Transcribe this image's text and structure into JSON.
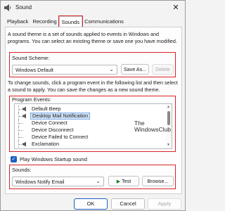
{
  "window": {
    "title": "Sound"
  },
  "tabs": [
    {
      "label": "Playback"
    },
    {
      "label": "Recording"
    },
    {
      "label": "Sounds"
    },
    {
      "label": "Communications"
    }
  ],
  "description": "A sound theme is a set of sounds applied to events in Windows and programs. You can select an existing theme or save one you have modified.",
  "scheme": {
    "label": "Sound Scheme:",
    "value": "Windows Default",
    "save_label": "Save As...",
    "delete_label": "Delete"
  },
  "instructions": "To change sounds, click a program event in the following list and then select a sound to apply. You can save the changes as a new sound theme.",
  "events": {
    "label": "Program Events:",
    "items": [
      "Default Beep",
      "Desktop Mail Notification",
      "Device Connect",
      "Device Disconnect",
      "Device Failed to Connect",
      "Exclamation"
    ],
    "selected_index": 1
  },
  "watermark": {
    "line1": "The",
    "line2": "WindowsClub"
  },
  "startup": {
    "label": "Play Windows Startup sound",
    "checked": true
  },
  "sounds": {
    "label": "Sounds:",
    "value": "Windows Notify Email",
    "test_label": "Test",
    "browse_label": "Browse..."
  },
  "footer": {
    "ok_label": "OK",
    "cancel_label": "Cancel",
    "apply_label": "Apply"
  },
  "colors": {
    "highlight": "#d8232a",
    "accent": "#1f5fbf",
    "selection": "#cfe3f7"
  }
}
